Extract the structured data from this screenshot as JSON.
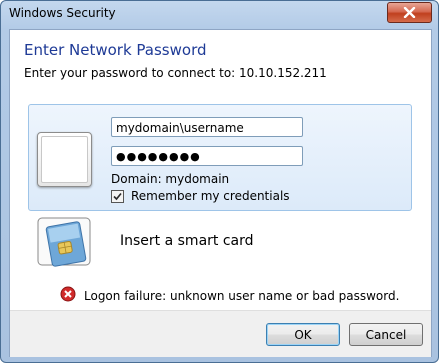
{
  "window": {
    "title": "Windows Security",
    "close_icon": "close-x-icon"
  },
  "header": {
    "heading": "Enter Network Password",
    "subheading": "Enter your password to connect to: 10.10.152.211"
  },
  "credentials": {
    "user_tile_icon": "user-tile-icon",
    "username_value": "mydomain\\username",
    "password_mask": "●●●●●●●●",
    "domain_text": "Domain: mydomain",
    "remember_label": "Remember my credentials",
    "remember_checked": true
  },
  "smartcard": {
    "icon": "smartcard-icon",
    "label": "Insert a smart card"
  },
  "error": {
    "icon": "error-icon",
    "message": "Logon failure: unknown user name or bad password."
  },
  "buttons": {
    "ok_label": "OK",
    "cancel_label": "Cancel"
  },
  "colors": {
    "heading": "#1e3a96",
    "panel_border": "#9ec4e8",
    "error_red": "#d12b2b"
  }
}
